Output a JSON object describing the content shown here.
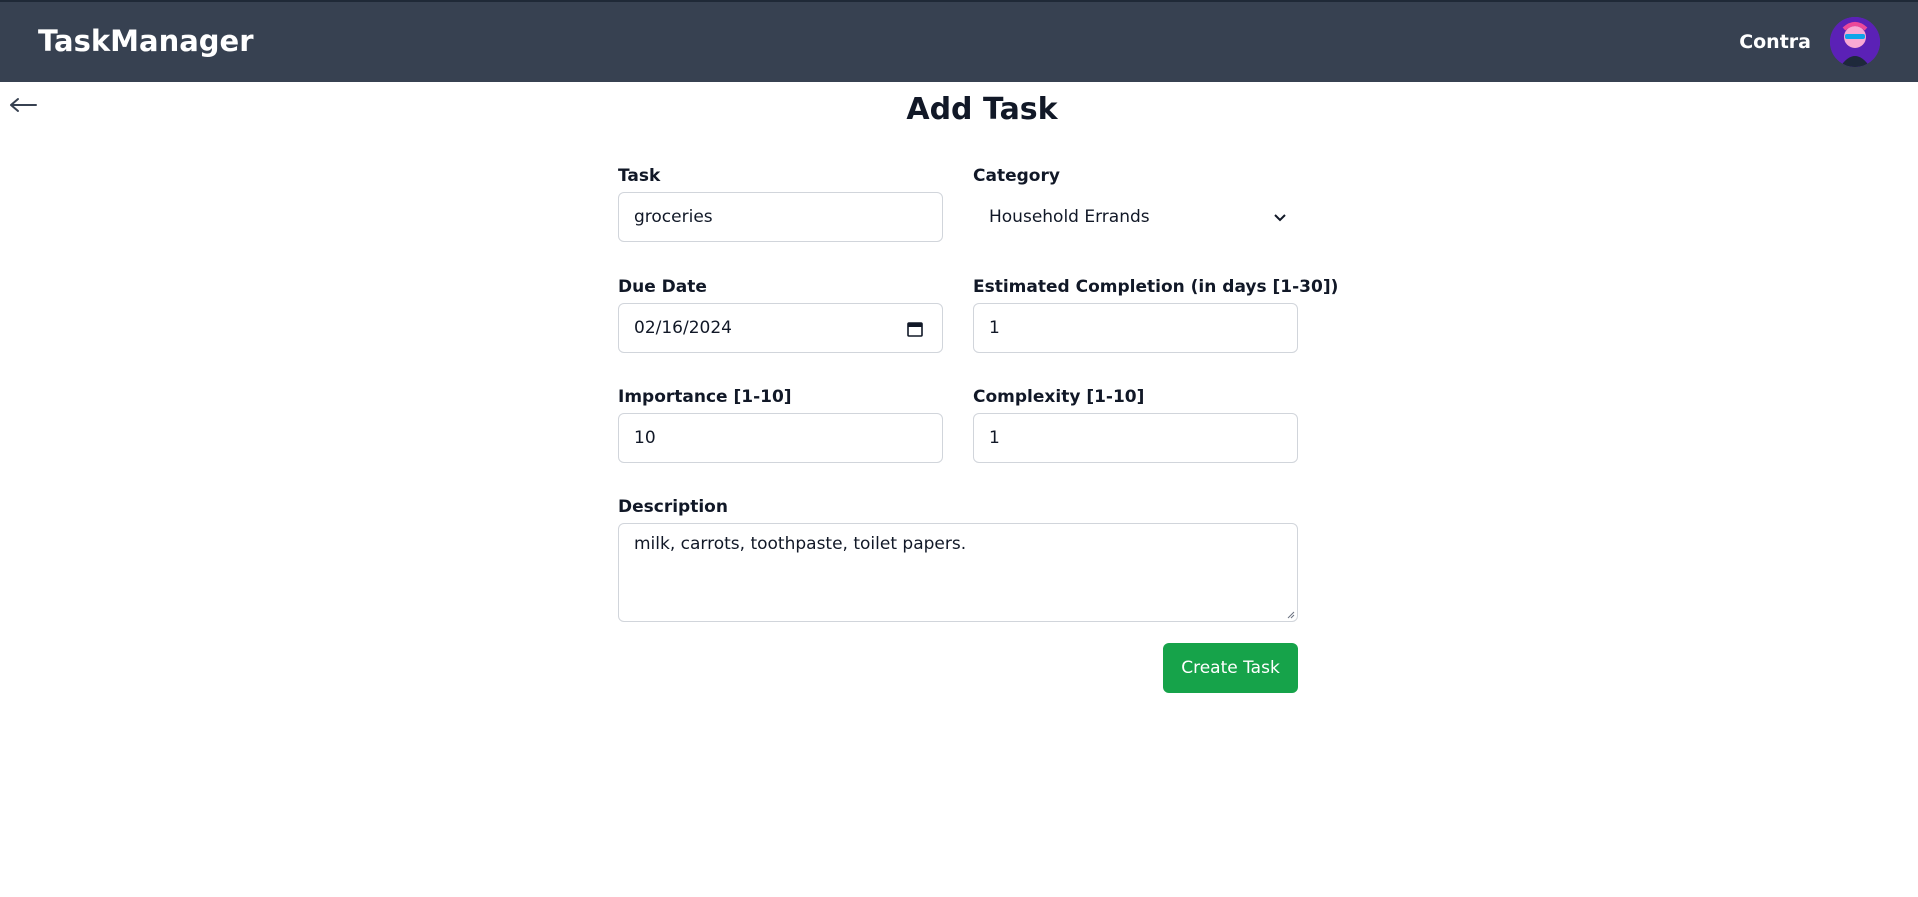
{
  "header": {
    "brand": "TaskManager",
    "username": "Contra"
  },
  "page": {
    "title": "Add Task",
    "back_icon": "arrow-left-icon"
  },
  "form": {
    "task_label": "Task",
    "task_value": "groceries",
    "category_label": "Category",
    "category_value": "Household Errands",
    "due_date_label": "Due Date",
    "due_date_value": "02/16/2024",
    "estimated_label": "Estimated Completion (in days [1-30])",
    "estimated_value": "1",
    "importance_label": "Importance [1-10]",
    "importance_value": "10",
    "complexity_label": "Complexity [1-10]",
    "complexity_value": "1",
    "description_label": "Description",
    "description_value": "milk, carrots, toothpaste, toilet papers.",
    "submit_label": "Create Task"
  },
  "colors": {
    "navbar": "#374151",
    "button": "#16a34a"
  }
}
